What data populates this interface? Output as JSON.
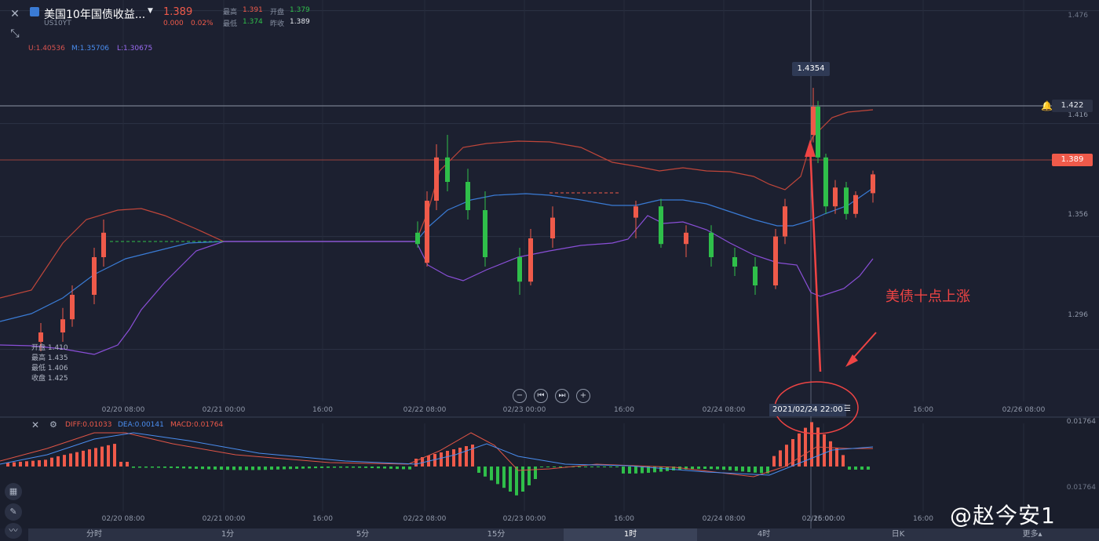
{
  "header": {
    "title": "美国10年国债收益...",
    "symbol": "US10YT",
    "price": "1.389",
    "change": "0.000",
    "change_pct": "0.02%",
    "stats": [
      {
        "label": "最高",
        "value": "1.391",
        "tone": "red"
      },
      {
        "label": "开盘",
        "value": "1.379",
        "tone": "grn"
      },
      {
        "label": "最低",
        "value": "1.374",
        "tone": "grn"
      },
      {
        "label": "昨收",
        "value": "1.389",
        "tone": "wht"
      }
    ]
  },
  "indicator": {
    "upper": "U:1.40536",
    "middle": "M:1.35706",
    "lower": "L:1.30675"
  },
  "ohlc_tooltip": {
    "open": "开盘 1.410",
    "high": "最高 1.435",
    "low": "最低 1.406",
    "close": "收盘 1.425"
  },
  "price_axis": {
    "ticks": [
      "1.476",
      "1.416",
      "1.356",
      "1.296"
    ],
    "alert_line_label": "1.422",
    "current_price_label": "1.389",
    "crosshair_tooltip": "1.4354"
  },
  "main_x_axis": {
    "labels": [
      "02/20 08:00",
      "02/21 00:00",
      "16:00",
      "02/22 08:00",
      "02/23 00:00",
      "16:00",
      "02/24 08:00",
      "16:00",
      "02/26 08:00"
    ],
    "crosshair_time": "2021/02/24 22:00"
  },
  "annotation_text": "美债十点上涨",
  "macd": {
    "diff": "DIFF:0.01033",
    "dea": "DEA:0.00141",
    "macd": "MACD:0.01764",
    "axis_top": "0.01764",
    "axis_bottom": "0.01764"
  },
  "macd_x_axis": {
    "labels": [
      "02/20 08:00",
      "02/21 00:00",
      "16:00",
      "02/22 08:00",
      "02/23 00:00",
      "16:00",
      "02/24 08:00",
      "16:00",
      "02/25 00:00",
      "16:00"
    ]
  },
  "timeframes": [
    "分时",
    "1分",
    "5分",
    "15分",
    "1时",
    "4时",
    "日K",
    "更多▴"
  ],
  "active_timeframe": "1时",
  "watermark": "@赵今安1",
  "colors": {
    "up": "#ef5a4a",
    "down": "#2fbf4a",
    "middle_band": "#3a7bd5",
    "lower_band": "#8a4fd8",
    "upper_band": "#c0463a",
    "bg": "#1c2030",
    "annotation": "#ef4444"
  },
  "chart_data": {
    "type": "candlestick",
    "interval": "1h",
    "y_range": [
      1.26,
      1.48
    ],
    "grid": true,
    "points": [
      {
        "t": "02/19 22:00",
        "o": 1.3,
        "h": 1.31,
        "l": 1.295,
        "c": 1.305
      },
      {
        "t": "02/20 02:00",
        "o": 1.305,
        "h": 1.318,
        "l": 1.3,
        "c": 1.312
      },
      {
        "t": "02/20 06:00",
        "o": 1.312,
        "h": 1.33,
        "l": 1.308,
        "c": 1.325
      },
      {
        "t": "02/20 08:00",
        "o": 1.325,
        "h": 1.35,
        "l": 1.32,
        "c": 1.345
      },
      {
        "t": "02/20 10:00",
        "o": 1.345,
        "h": 1.365,
        "l": 1.34,
        "c": 1.358
      },
      {
        "t": "02/20 12:00",
        "o": 1.358,
        "h": 1.364,
        "l": 1.35,
        "c": 1.352
      },
      {
        "t": "02/22 06:00",
        "o": 1.342,
        "h": 1.38,
        "l": 1.34,
        "c": 1.375
      },
      {
        "t": "02/22 09:00",
        "o": 1.375,
        "h": 1.405,
        "l": 1.37,
        "c": 1.398
      },
      {
        "t": "02/22 12:00",
        "o": 1.398,
        "h": 1.41,
        "l": 1.38,
        "c": 1.385
      },
      {
        "t": "02/22 16:00",
        "o": 1.385,
        "h": 1.392,
        "l": 1.365,
        "c": 1.37
      },
      {
        "t": "02/22 20:00",
        "o": 1.37,
        "h": 1.38,
        "l": 1.34,
        "c": 1.345
      },
      {
        "t": "02/23 00:00",
        "o": 1.345,
        "h": 1.35,
        "l": 1.325,
        "c": 1.332
      },
      {
        "t": "02/23 04:00",
        "o": 1.332,
        "h": 1.36,
        "l": 1.33,
        "c": 1.355
      },
      {
        "t": "02/23 10:00",
        "o": 1.355,
        "h": 1.372,
        "l": 1.35,
        "c": 1.366
      },
      {
        "t": "02/23 18:00",
        "o": 1.366,
        "h": 1.375,
        "l": 1.355,
        "c": 1.372
      },
      {
        "t": "02/23 22:00",
        "o": 1.372,
        "h": 1.376,
        "l": 1.35,
        "c": 1.352
      },
      {
        "t": "02/24 02:00",
        "o": 1.352,
        "h": 1.362,
        "l": 1.345,
        "c": 1.358
      },
      {
        "t": "02/24 06:00",
        "o": 1.358,
        "h": 1.362,
        "l": 1.34,
        "c": 1.345
      },
      {
        "t": "02/24 10:00",
        "o": 1.345,
        "h": 1.35,
        "l": 1.335,
        "c": 1.34
      },
      {
        "t": "02/24 14:00",
        "o": 1.34,
        "h": 1.345,
        "l": 1.325,
        "c": 1.33
      },
      {
        "t": "02/24 18:00",
        "o": 1.33,
        "h": 1.36,
        "l": 1.328,
        "c": 1.356
      },
      {
        "t": "02/24 20:00",
        "o": 1.356,
        "h": 1.376,
        "l": 1.352,
        "c": 1.372
      },
      {
        "t": "02/24 22:00",
        "o": 1.41,
        "h": 1.435,
        "l": 1.406,
        "c": 1.425
      },
      {
        "t": "02/24 23:00",
        "o": 1.425,
        "h": 1.428,
        "l": 1.395,
        "c": 1.398
      },
      {
        "t": "02/25 01:00",
        "o": 1.398,
        "h": 1.4,
        "l": 1.368,
        "c": 1.372
      },
      {
        "t": "02/25 03:00",
        "o": 1.372,
        "h": 1.386,
        "l": 1.368,
        "c": 1.382
      },
      {
        "t": "02/25 05:00",
        "o": 1.382,
        "h": 1.385,
        "l": 1.365,
        "c": 1.368
      },
      {
        "t": "02/25 07:00",
        "o": 1.368,
        "h": 1.38,
        "l": 1.366,
        "c": 1.378
      },
      {
        "t": "02/25 08:00",
        "o": 1.379,
        "h": 1.391,
        "l": 1.374,
        "c": 1.389
      }
    ]
  }
}
